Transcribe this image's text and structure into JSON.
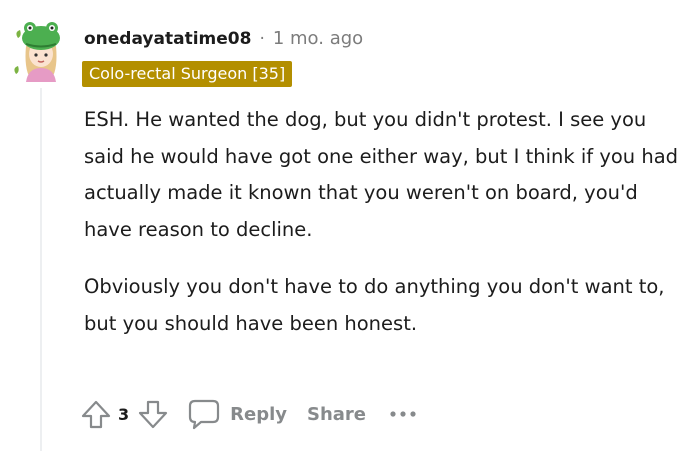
{
  "comment": {
    "username": "onedayatatime08",
    "separator": "·",
    "timestamp": "1 mo. ago",
    "flair": "Colo-rectal Surgeon [35]",
    "paragraphs": [
      "ESH. He wanted the dog, but you didn't protest. I see you said he would have got one either way, but I think if you had actually made it known that you weren't on board, you'd have reason to decline.",
      "Obviously you don't have to do anything you don't want to, but you should have been honest."
    ]
  },
  "actions": {
    "upvote_icon": "upvote-arrow-icon",
    "vote_count": "3",
    "downvote_icon": "downvote-arrow-icon",
    "reply_icon": "comment-bubble-icon",
    "reply_label": "Reply",
    "share_label": "Share",
    "more_icon": "ellipsis-icon"
  },
  "colors": {
    "flair_bg": "#b38f00",
    "muted_text": "#7c7c7c",
    "action_gray": "#878a8c",
    "thread_line": "#edeff1"
  }
}
